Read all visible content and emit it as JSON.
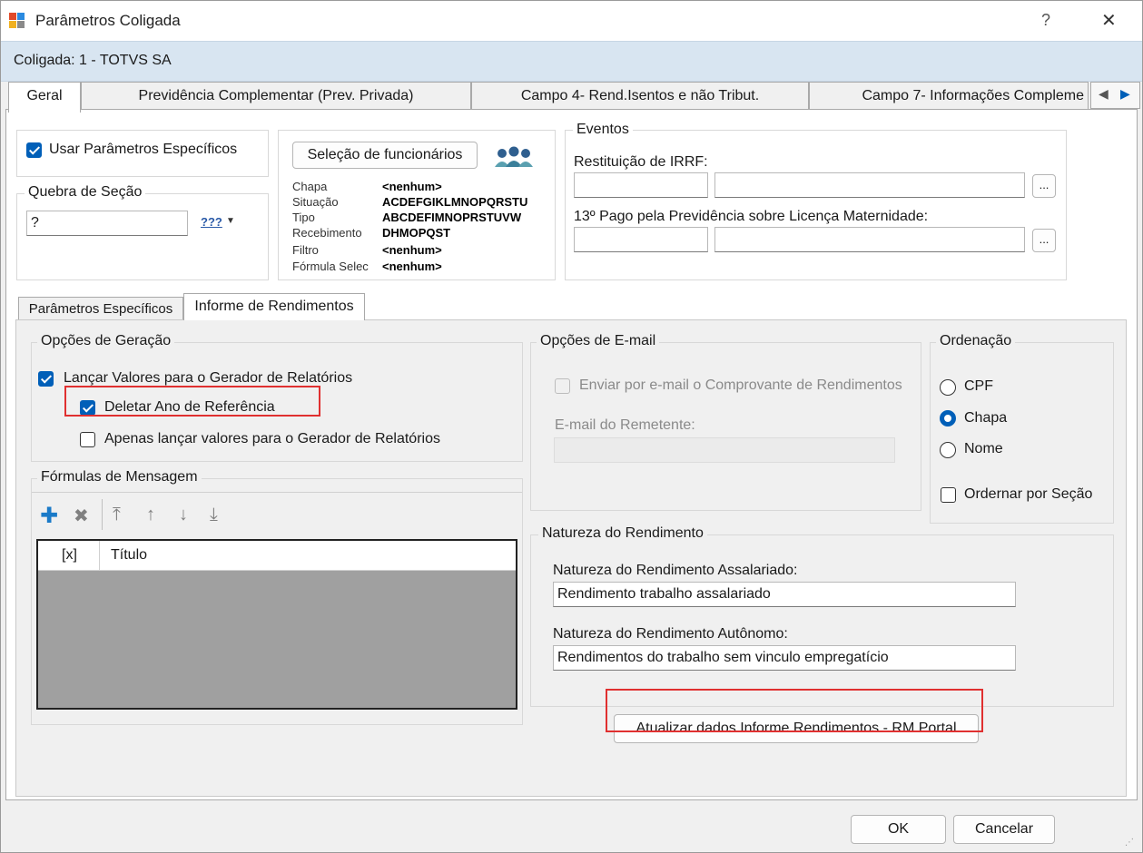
{
  "window": {
    "title": "Parâmetros Coligada",
    "help_label": "?",
    "close_label": "✕"
  },
  "coligada": "Coligada: 1 - TOTVS SA",
  "tabs": [
    {
      "label": "Geral"
    },
    {
      "label": "Previdência Complementar (Prev. Privada)"
    },
    {
      "label": "Campo 4- Rend.Isentos e não Tribut."
    },
    {
      "label": "Campo 7- Informações Compleme"
    }
  ],
  "geral": {
    "usar_parametros_label": "Usar Parâmetros Específicos",
    "quebra_legend": "Quebra de Seção",
    "quebra_value": "?",
    "quebra_btn": "???",
    "selecao_btn": "Seleção de funcionários",
    "filters": [
      {
        "label": "Chapa",
        "value": "<nenhum>"
      },
      {
        "label": "Situação",
        "value": "ACDEFGIKLMNOPQRSTU"
      },
      {
        "label": "Tipo",
        "value": "ABCDEFIMNOPRSTUVW"
      },
      {
        "label": "Recebimento",
        "value": "DHMOPQST"
      },
      {
        "label": "Filtro",
        "value": "<nenhum>"
      },
      {
        "label": "Fórmula Selec",
        "value": "<nenhum>"
      }
    ],
    "eventos_legend": "Eventos",
    "restituicao_label": "Restituição de IRRF:",
    "decimo_label": "13º Pago pela Previdência sobre Licença Maternidade:",
    "ellipsis": "..."
  },
  "subtabs": [
    {
      "label": "Parâmetros Específicos"
    },
    {
      "label": "Informe de Rendimentos"
    }
  ],
  "opcoes_geracao": {
    "legend": "Opções de Geração",
    "lancar_label": "Lançar Valores para o Gerador de Relatórios",
    "deletar_label": "Deletar Ano de Referência",
    "apenas_label": "Apenas lançar valores para o Gerador de Relatórios"
  },
  "formulas": {
    "legend": "Fórmulas de Mensagem",
    "col_x": "[x]",
    "col_titulo": "Título"
  },
  "opcoes_email": {
    "legend": "Opções de E-mail",
    "enviar_label": "Enviar por e-mail o Comprovante de Rendimentos",
    "email_label": "E-mail do Remetente:",
    "email_value": ""
  },
  "ordenacao": {
    "legend": "Ordenação",
    "options": [
      {
        "label": "CPF"
      },
      {
        "label": "Chapa"
      },
      {
        "label": "Nome"
      }
    ],
    "ordenar_secao_label": "Ordernar por Seção"
  },
  "natureza": {
    "legend": "Natureza do Rendimento",
    "assalariado_label": "Natureza do Rendimento Assalariado:",
    "assalariado_value": "Rendimento trabalho assalariado",
    "autonomo_label": "Natureza do Rendimento Autônomo:",
    "autonomo_value": "Rendimentos do trabalho sem vinculo empregatício"
  },
  "atualizar_btn": "Atualizar dados Informe Rendimentos - RM Portal",
  "footer": {
    "ok_label": "OK",
    "cancel_label": "Cancelar"
  },
  "colors": {
    "accent": "#005fb8",
    "highlight": "#e03030",
    "info_bar": "#d8e5f1"
  }
}
